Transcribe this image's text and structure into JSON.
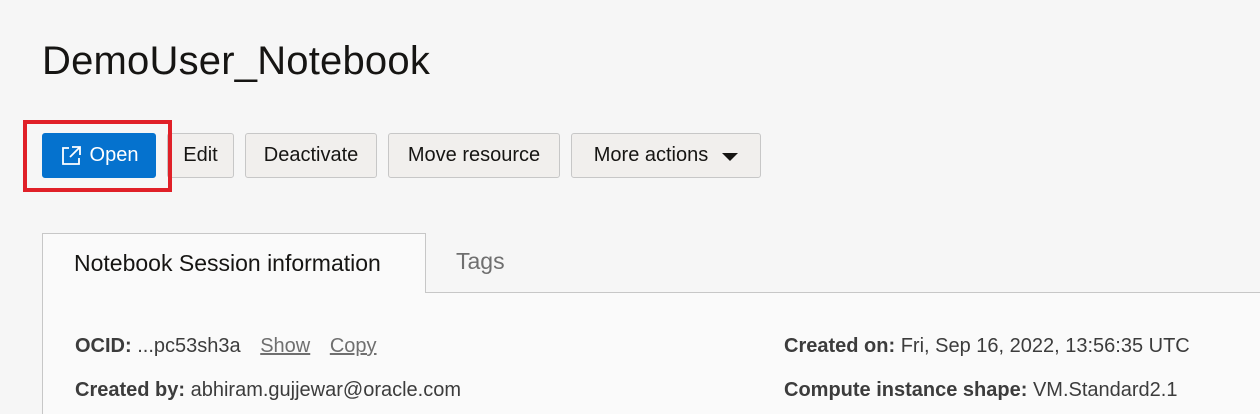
{
  "page": {
    "title": "DemoUser_Notebook"
  },
  "toolbar": {
    "open_label": "Open",
    "edit_label": "Edit",
    "deactivate_label": "Deactivate",
    "move_label": "Move resource",
    "more_label": "More actions"
  },
  "tabs": [
    {
      "label": "Notebook Session information",
      "active": true
    },
    {
      "label": "Tags",
      "active": false
    }
  ],
  "details": {
    "ocid_label": "OCID:",
    "ocid_value": "...pc53sh3a",
    "show_link": "Show",
    "copy_link": "Copy",
    "created_by_label": "Created by:",
    "created_by_value": "abhiram.gujjewar@oracle.com",
    "created_on_label": "Created on:",
    "created_on_value": "Fri, Sep 16, 2022, 13:56:35 UTC",
    "shape_label": "Compute instance shape:",
    "shape_value": "VM.Standard2.1"
  },
  "colors": {
    "primary": "#0572ce",
    "highlight": "#e02028"
  },
  "icons": {
    "open": "external-link-icon",
    "more": "caret-down-icon"
  }
}
